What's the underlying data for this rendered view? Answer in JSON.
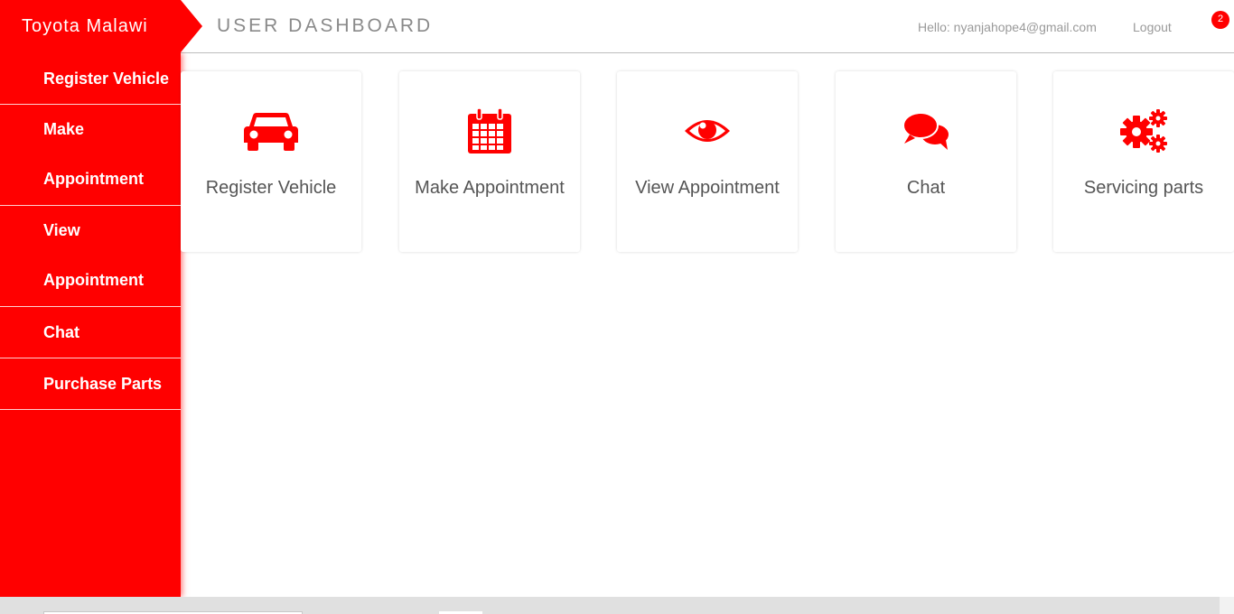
{
  "brand": {
    "name": "Toyota Malawi"
  },
  "header": {
    "title": "USER DASHBOARD",
    "greeting": "Hello: nyanjahope4@gmail.com",
    "logout_label": "Logout",
    "notification_count": "2"
  },
  "sidebar": {
    "items": [
      {
        "label": "Register Vehicle"
      },
      {
        "label_line1": "Make",
        "label_line2": "Appointment"
      },
      {
        "label_line1": "View",
        "label_line2": "Appointment"
      },
      {
        "label": "Chat"
      },
      {
        "label": "Purchase Parts"
      }
    ]
  },
  "cards": [
    {
      "label": "Register Vehicle",
      "icon": "car-icon"
    },
    {
      "label": "Make Appointment",
      "icon": "calendar-icon"
    },
    {
      "label": "View Appointment",
      "icon": "eye-icon"
    },
    {
      "label": "Chat",
      "icon": "chat-icon"
    },
    {
      "label": "Servicing parts",
      "icon": "gears-icon"
    }
  ],
  "colors": {
    "accent": "#ff0000",
    "text_muted": "#9a9a9a",
    "card_text": "#555555"
  }
}
